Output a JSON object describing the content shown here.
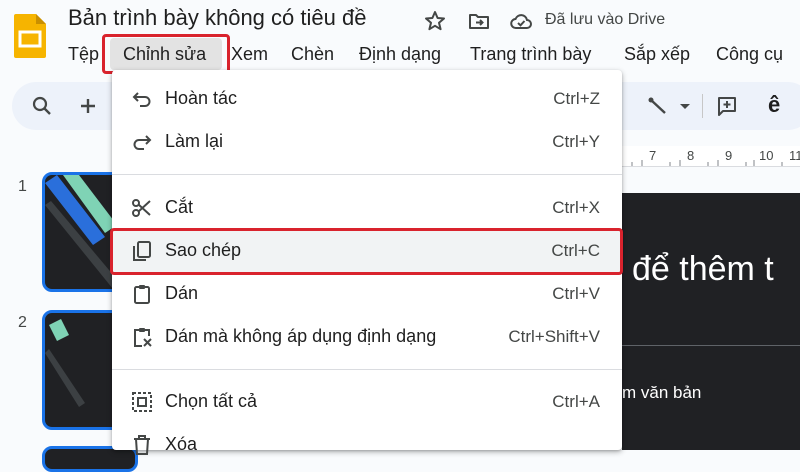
{
  "app": {
    "title": "Bản trình bày không có tiêu đề",
    "saved_status": "Đã lưu vào Drive"
  },
  "menubar": {
    "items": [
      "Tệp",
      "Chỉnh sửa",
      "Xem",
      "Chèn",
      "Định dạng",
      "Trang trình bày",
      "Sắp xếp",
      "Công cụ"
    ],
    "active_index": 1
  },
  "edit_menu": {
    "items": [
      {
        "label": "Hoàn tác",
        "shortcut": "Ctrl+Z",
        "icon": "undo-icon"
      },
      {
        "label": "Làm lại",
        "shortcut": "Ctrl+Y",
        "icon": "redo-icon"
      },
      {
        "label": "Cắt",
        "shortcut": "Ctrl+X",
        "icon": "scissors-icon"
      },
      {
        "label": "Sao chép",
        "shortcut": "Ctrl+C",
        "icon": "copy-icon"
      },
      {
        "label": "Dán",
        "shortcut": "Ctrl+V",
        "icon": "clipboard-icon"
      },
      {
        "label": "Dán mà không áp dụng định dạng",
        "shortcut": "Ctrl+Shift+V",
        "icon": "paste-plain-icon"
      },
      {
        "label": "Chọn tất cả",
        "shortcut": "Ctrl+A",
        "icon": "select-all-icon"
      },
      {
        "label": "Xóa",
        "shortcut": "",
        "icon": "trash-icon"
      }
    ],
    "highlighted": "Sao chép"
  },
  "ruler": {
    "numbers": [
      "7",
      "8",
      "9",
      "10",
      "11"
    ]
  },
  "slides": {
    "numbers": [
      "1",
      "2"
    ]
  },
  "slide_canvas": {
    "title_fragment": "để thêm t",
    "body_fragment": "m văn bản"
  },
  "toolbar": {
    "letter": "ê"
  },
  "colors": {
    "accent": "#1a73e8",
    "highlight_box": "#d9232d",
    "slides_logo": "#f6b400",
    "slide_bg": "#202124"
  }
}
